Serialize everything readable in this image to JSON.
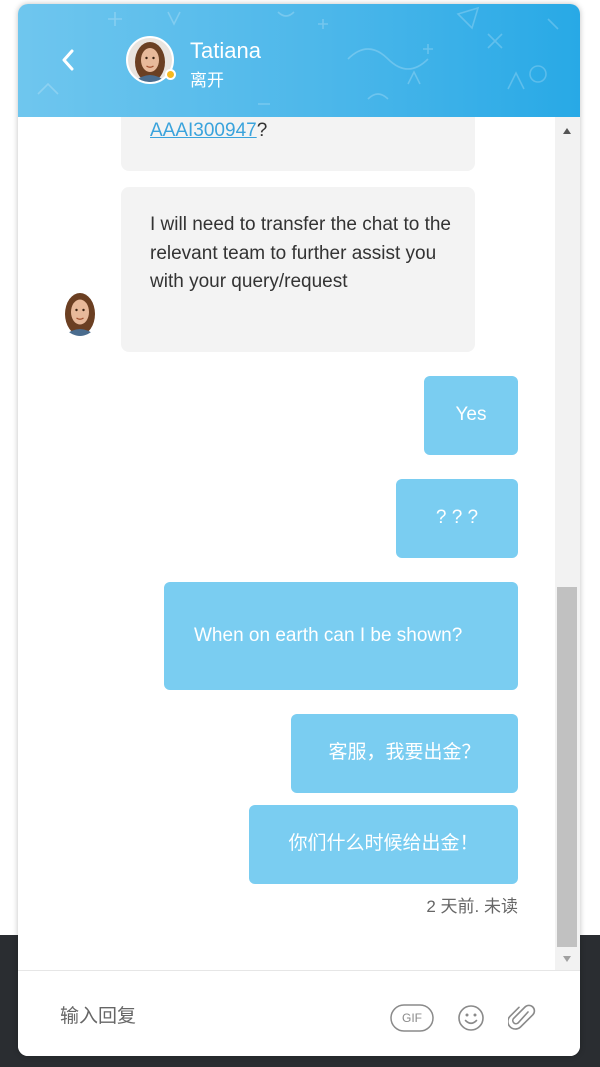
{
  "header": {
    "agent_name": "Tatiana",
    "agent_status": "离开",
    "status_color": "#f5b921",
    "gradient_colors": [
      "#6fc6ee",
      "#28a9e6"
    ]
  },
  "messages": {
    "incoming": [
      {
        "link_text": "AAAI300947",
        "suffix": "?"
      },
      {
        "text": "I will need to transfer the chat to the relevant team to further assist you with your query/request"
      }
    ],
    "outgoing": [
      {
        "text": "Yes"
      },
      {
        "text": "? ? ?"
      },
      {
        "text": "When on earth can I be shown?"
      },
      {
        "text": "客服，我要出金？"
      },
      {
        "text": "你们什么时候给出金！"
      }
    ],
    "timestamp": "2 天前. 未读"
  },
  "composer": {
    "placeholder": "输入回复",
    "gif_label": "GIF",
    "icons": [
      "gif-icon",
      "emoji-icon",
      "paperclip-icon"
    ]
  },
  "colors": {
    "outgoing_bubble": "#7acdf1",
    "incoming_bubble": "#f3f3f3",
    "link": "#3aa3dc"
  }
}
